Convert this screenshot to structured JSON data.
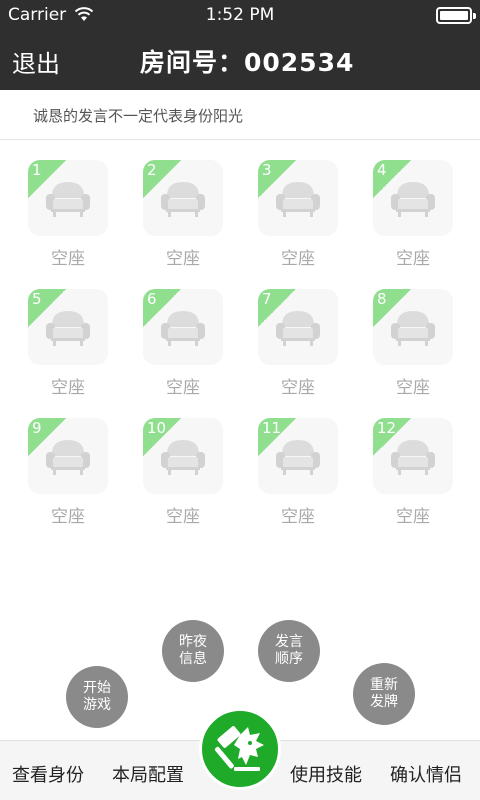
{
  "status_bar": {
    "carrier": "Carrier",
    "time": "1:52 PM",
    "battery_level": 1.0
  },
  "nav": {
    "exit_label": "退出",
    "room_label": "房间号：002534"
  },
  "notice": "诚恳的发言不一定代表身份阳光",
  "seats": [
    {
      "number": "1",
      "label": "空座"
    },
    {
      "number": "2",
      "label": "空座"
    },
    {
      "number": "3",
      "label": "空座"
    },
    {
      "number": "4",
      "label": "空座"
    },
    {
      "number": "5",
      "label": "空座"
    },
    {
      "number": "6",
      "label": "空座"
    },
    {
      "number": "7",
      "label": "空座"
    },
    {
      "number": "8",
      "label": "空座"
    },
    {
      "number": "9",
      "label": "空座"
    },
    {
      "number": "10",
      "label": "空座"
    },
    {
      "number": "11",
      "label": "空座"
    },
    {
      "number": "12",
      "label": "空座"
    }
  ],
  "actions": {
    "start_game": "开始\n游戏",
    "last_night_info": "昨夜\n信息",
    "speak_order": "发言\n顺序",
    "redeal": "重新\n发牌"
  },
  "bottom_tabs": {
    "view_identity": "查看身份",
    "round_config": "本局配置",
    "use_skill": "使用技能",
    "confirm_status": "确认情侣"
  },
  "colors": {
    "accent_green": "#1faa2a",
    "ribbon_green": "#8fdf8f",
    "header": "#2f2f2f"
  },
  "center_icon": "hammer-wolf-icon"
}
